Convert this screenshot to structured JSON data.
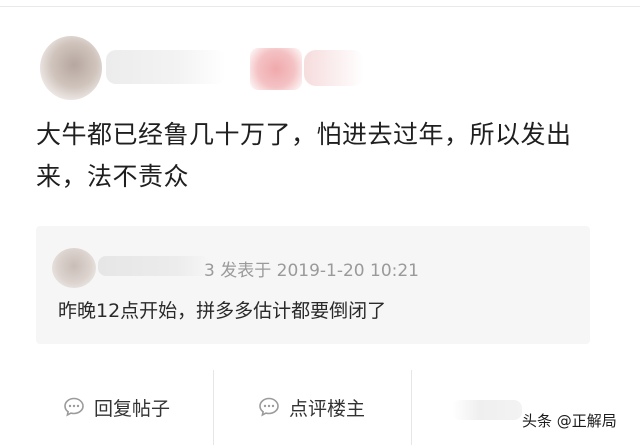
{
  "post": {
    "text": "大牛都已经鲁几十万了，怕进去过年，所以发出来，法不责众"
  },
  "quote": {
    "meta_suffix": "3 发表于 2019-1-20 10:21",
    "text": "昨晚12点开始，拼多多估计都要倒闭了"
  },
  "actions": {
    "reply_label": "回复帖子",
    "comment_owner_label": "点评楼主"
  },
  "watermark": {
    "text": "头条 @正解局"
  },
  "icons": {
    "reply": "comment-bubble-icon",
    "comment": "comment-bubble-icon"
  },
  "colors": {
    "icon_gray": "#9b9b9b",
    "meta_gray": "#9a9a9a",
    "quote_bg": "#f6f6f6"
  }
}
